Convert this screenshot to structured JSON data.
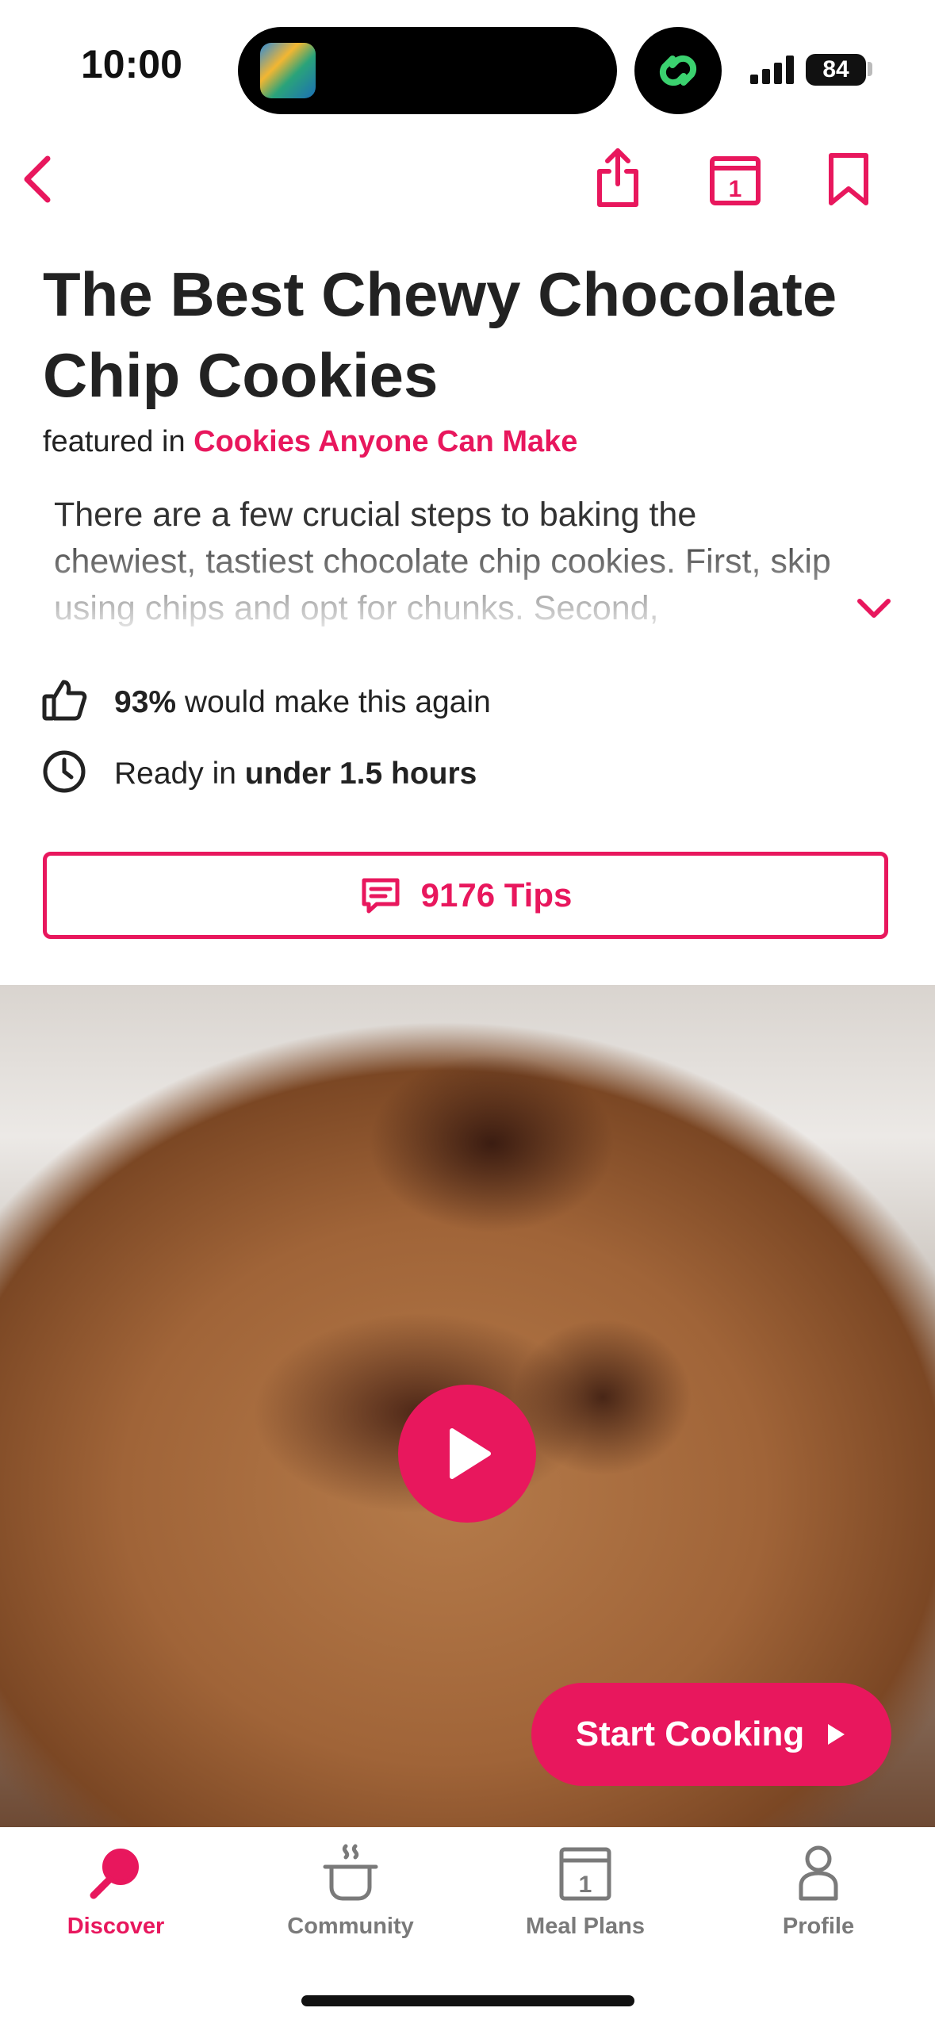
{
  "status_bar": {
    "time": "10:00",
    "battery": "84"
  },
  "recipe": {
    "title": "The Best Chewy Chocolate Chip Cookies",
    "featured_prefix": "featured in",
    "featured_collection": "Cookies Anyone Can Make",
    "description": "There are a few crucial steps to baking the chewiest, tastiest chocolate chip cookies. First, skip using chips and opt for chunks. Second,",
    "rating_percent": "93%",
    "rating_text": "would make this again",
    "ready_prefix": "Ready in",
    "ready_time": "under 1.5 hours",
    "tips_label": "9176 Tips",
    "start_label": "Start Cooking"
  },
  "tabs": [
    {
      "label": "Discover",
      "icon": "discover-icon",
      "active": true
    },
    {
      "label": "Community",
      "icon": "community-icon",
      "active": false
    },
    {
      "label": "Meal Plans",
      "icon": "meal-plans-icon",
      "active": false
    },
    {
      "label": "Profile",
      "icon": "profile-icon",
      "active": false
    }
  ],
  "colors": {
    "accent": "#e8175d",
    "text": "#222222",
    "inactive": "#7a7a7a"
  }
}
